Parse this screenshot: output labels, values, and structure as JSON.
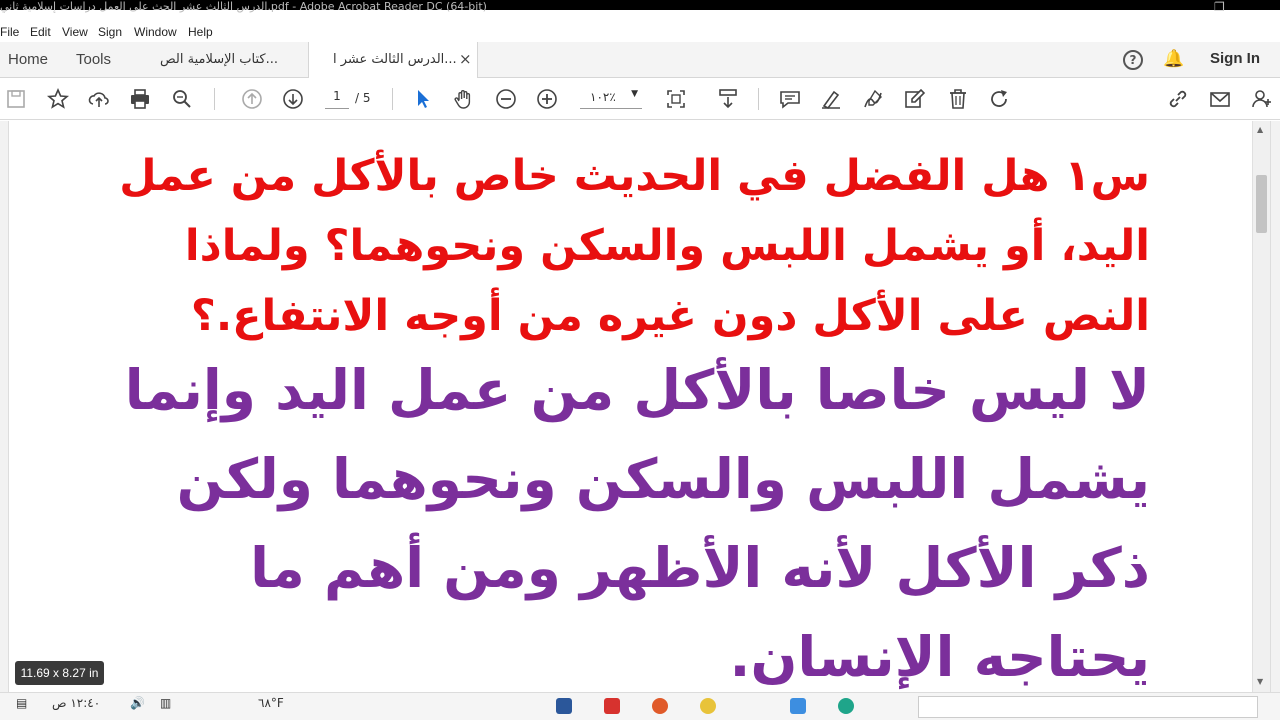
{
  "window": {
    "title": "الدرس الثالث عشر الحث على العمل دراسات إسلامية ثاني.pdf - Adobe Acrobat Reader DC (64-bit)"
  },
  "menu": [
    "File",
    "Edit",
    "View",
    "Sign",
    "Window",
    "Help"
  ],
  "tabs": {
    "home": "Home",
    "tools": "Tools",
    "doc1": "كتاب الإسلامية الص...",
    "doc2": "الدرس الثالث عشر ا...",
    "close": "×",
    "help": "?",
    "signin": "Sign In"
  },
  "toolbar": {
    "page_current": "1",
    "page_total": "/ 5",
    "zoom": "١٠٢٪",
    "icons": [
      "save-icon",
      "star-icon",
      "upload-icon",
      "print-icon",
      "search-icon",
      "prev-page-icon",
      "next-page-icon",
      "select-cursor-icon",
      "hand-icon",
      "zoom-out-icon",
      "zoom-in-icon",
      "fit-page-icon",
      "scroll-mode-icon",
      "comment-icon",
      "highlight-icon",
      "sign-icon",
      "edit-icon",
      "delete-icon",
      "rotate-icon",
      "link-icon",
      "email-icon",
      "add-user-icon"
    ]
  },
  "document": {
    "question": "س١ هل الفضل في الحديث خاص بالأكل من عمل اليد، أو يشمل اللبس والسكن ونحوهما؟ ولماذا النص على الأكل دون غيره من أوجه الانتفاع.؟",
    "answer": "لا ليس خاصا بالأكل من عمل اليد وإنما يشمل اللبس والسكن ونحوهما ولكن ذكر الأكل لأنه الأظهر ومن أهم ما يحتاجه الإنسان.",
    "question_color": "#e81010",
    "answer_color": "#7b2f9b"
  },
  "status": {
    "page_size": "11.69 x 8.27 in"
  },
  "taskbar": {
    "time": "١٢:٤٠ ص",
    "temp": "٦٨°F"
  }
}
